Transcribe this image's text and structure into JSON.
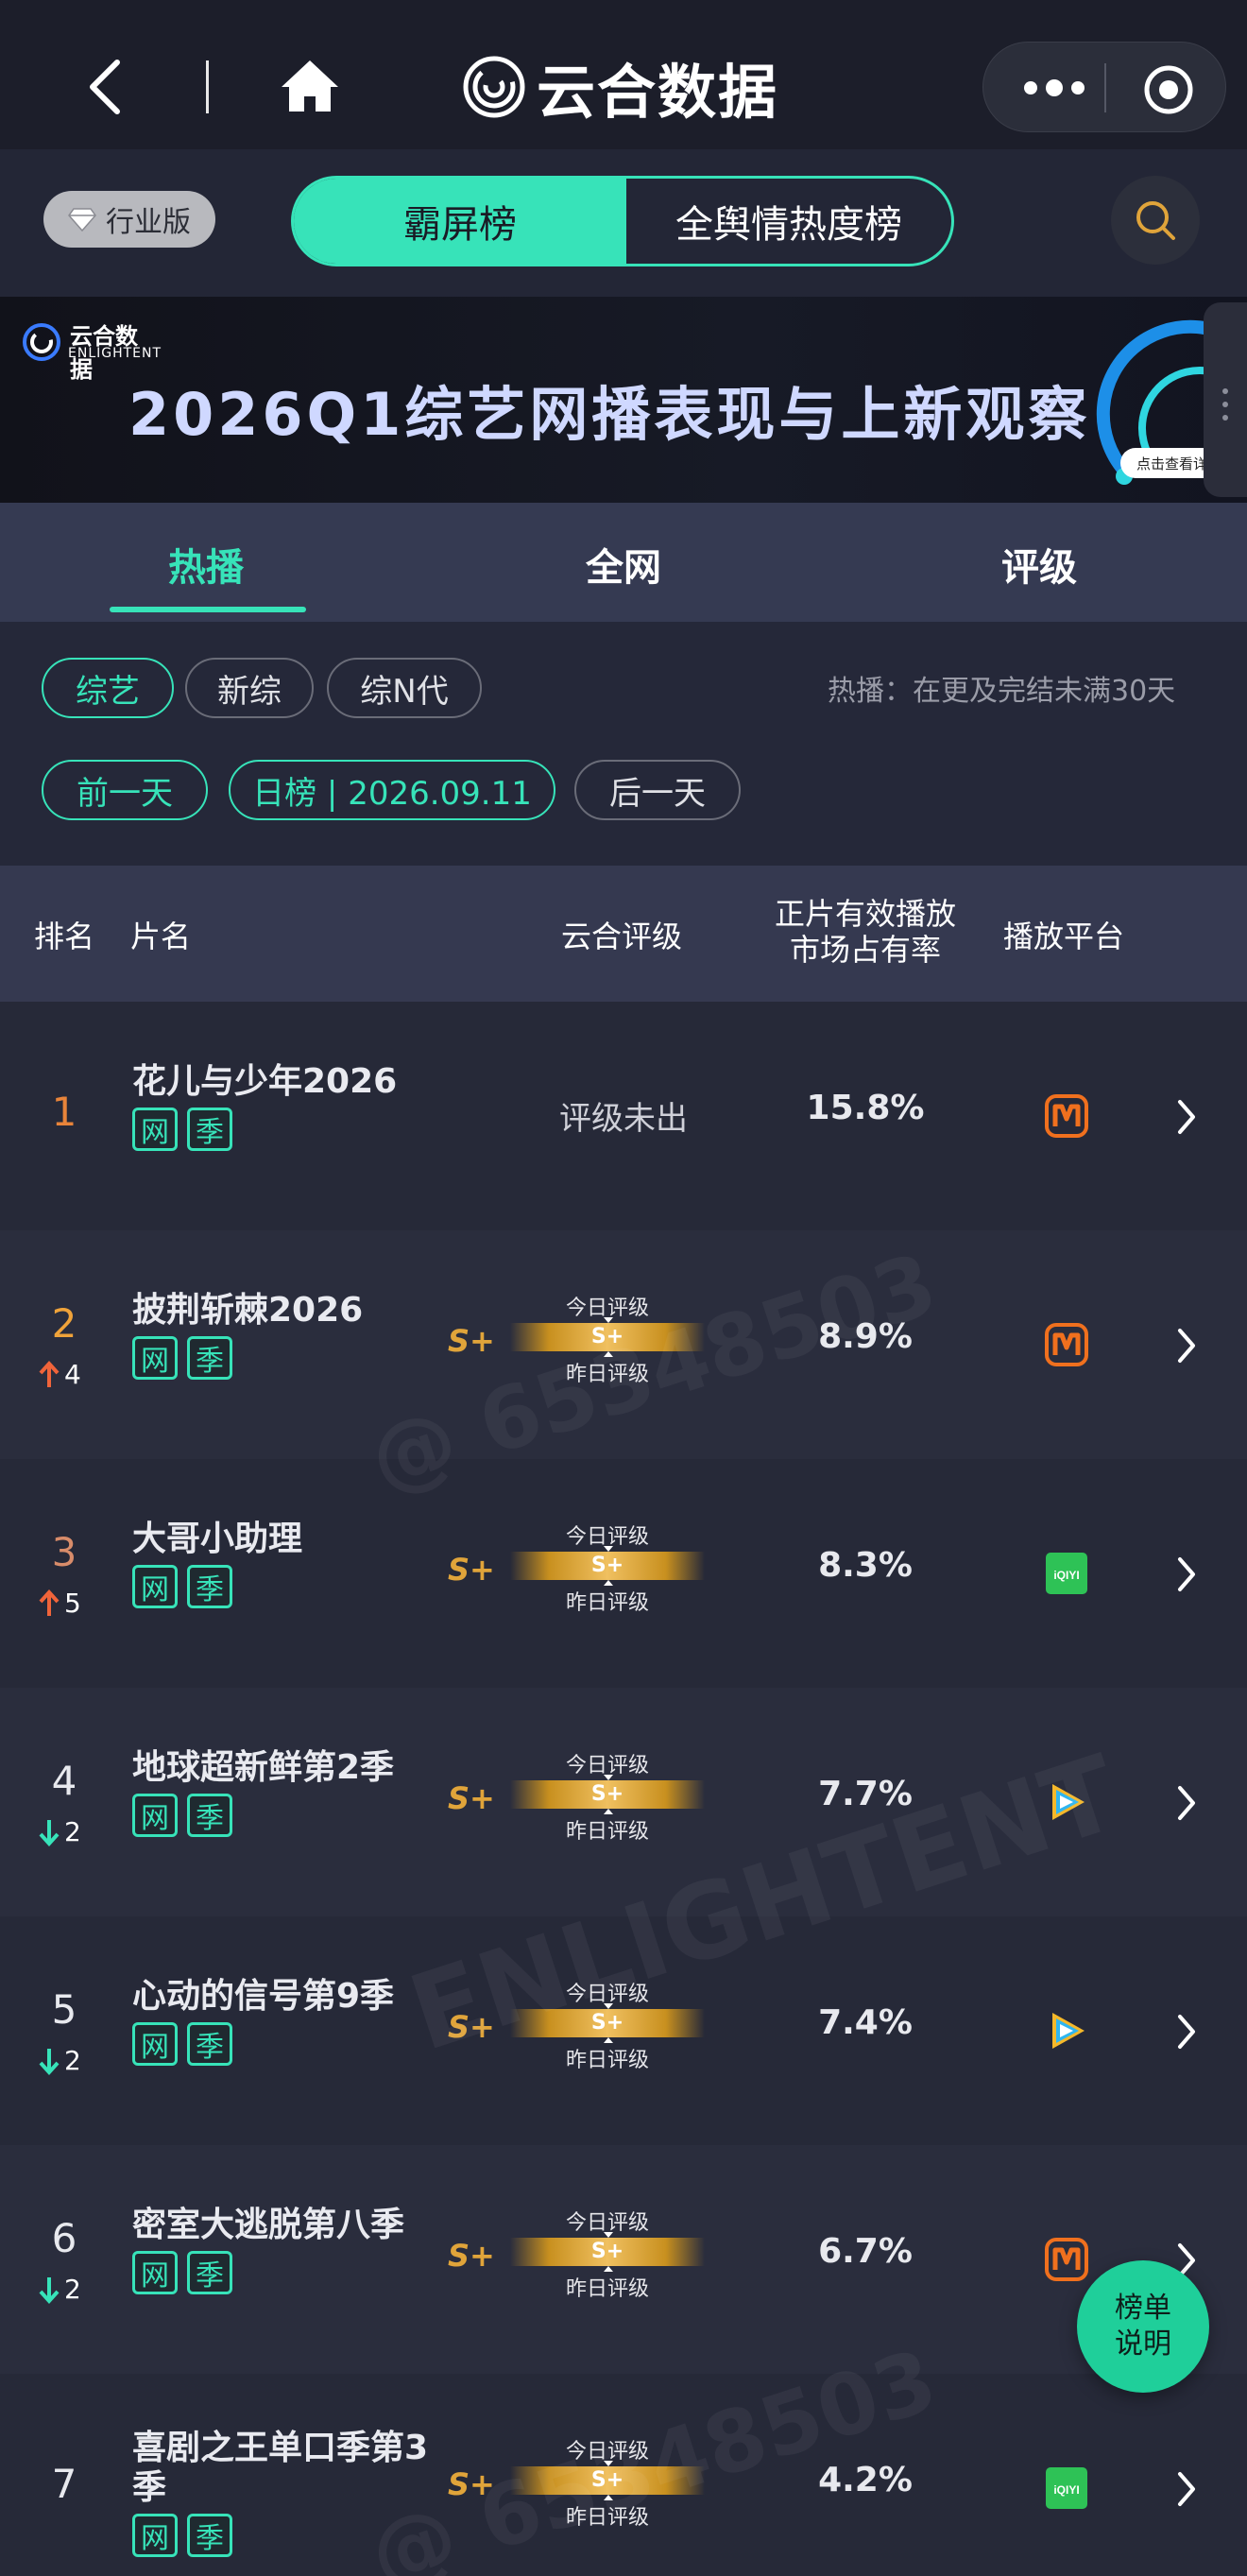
{
  "app": {
    "title": "云合数据"
  },
  "topbar": {
    "back_icon": "back-chevron-icon",
    "home_icon": "home-icon",
    "more_icon": "more-dots-icon",
    "close_icon": "target-icon"
  },
  "header": {
    "industry_label": "行业版",
    "segments": [
      "霸屏榜",
      "全舆情热度榜"
    ],
    "active_segment": "霸屏榜"
  },
  "banner": {
    "logo_cn": "云合数据",
    "logo_en": "ENLIGHTENT",
    "title": "2026Q1综艺网播表现与上新观察",
    "cta": "点击查看详情"
  },
  "tabs": [
    "热播",
    "全网",
    "评级"
  ],
  "active_tab": "热播",
  "filters": {
    "categories": [
      "综艺",
      "新综",
      "综N代"
    ],
    "active_category": "综艺",
    "hint": "热播：在更及完结未满30天",
    "prev_day": "前一天",
    "date_label": "日榜 | 2026.09.11",
    "next_day": "后一天"
  },
  "table": {
    "headers": {
      "rank": "排名",
      "title": "片名",
      "rating": "云合评级",
      "share_line1": "正片有效播放",
      "share_line2": "市场占有率",
      "platform": "播放平台"
    },
    "rating_today_label": "今日评级",
    "rating_yesterday_label": "昨日评级",
    "rows": [
      {
        "rank": "1",
        "change": "",
        "direction": "",
        "title": "花儿与少年2026",
        "tags": [
          "网",
          "季"
        ],
        "rating_text": "评级未出",
        "rating": "",
        "grade": "",
        "share": "15.8%",
        "platform": "mango",
        "rank_color": "#e8843a"
      },
      {
        "rank": "2",
        "change": "4",
        "direction": "up",
        "title": "披荆斩棘2026",
        "tags": [
          "网",
          "季"
        ],
        "rating_text": "",
        "rating": "S+",
        "grade": "S+",
        "share": "8.9%",
        "platform": "mango",
        "rank_color": "#f0a33a"
      },
      {
        "rank": "3",
        "change": "5",
        "direction": "up",
        "title": "大哥小助理",
        "tags": [
          "网",
          "季"
        ],
        "rating_text": "",
        "rating": "S+",
        "grade": "S+",
        "share": "8.3%",
        "platform": "iqiyi",
        "rank_color": "#d88c6a"
      },
      {
        "rank": "4",
        "change": "2",
        "direction": "down",
        "title": "地球超新鲜第2季",
        "tags": [
          "网",
          "季"
        ],
        "rating_text": "",
        "rating": "S+",
        "grade": "S+",
        "share": "7.7%",
        "platform": "tencent",
        "rank_color": "#e8e9ee"
      },
      {
        "rank": "5",
        "change": "2",
        "direction": "down",
        "title": "心动的信号第9季",
        "tags": [
          "网",
          "季"
        ],
        "rating_text": "",
        "rating": "S+",
        "grade": "S+",
        "share": "7.4%",
        "platform": "tencent",
        "rank_color": "#e8e9ee"
      },
      {
        "rank": "6",
        "change": "2",
        "direction": "down",
        "title": "密室大逃脱第八季",
        "tags": [
          "网",
          "季"
        ],
        "rating_text": "",
        "rating": "S+",
        "grade": "S+",
        "share": "6.7%",
        "platform": "mango",
        "rank_color": "#e8e9ee"
      },
      {
        "rank": "7",
        "change": "",
        "direction": "",
        "title_line1": "喜剧之王单口季第3",
        "title_line2": "季",
        "tags": [
          "网",
          "季"
        ],
        "rating_text": "",
        "rating": "S+",
        "grade": "S+",
        "share": "4.2%",
        "platform": "iqiyi",
        "rank_color": "#e8e9ee"
      }
    ]
  },
  "float_button": {
    "line1": "榜单",
    "line2": "说明"
  },
  "colors": {
    "accent": "#37e3b9",
    "gold": "#e0a43a",
    "up": "#f0643a",
    "down": "#37e3b9",
    "mango": "#f0701e",
    "iqiyi": "#2ec256"
  }
}
